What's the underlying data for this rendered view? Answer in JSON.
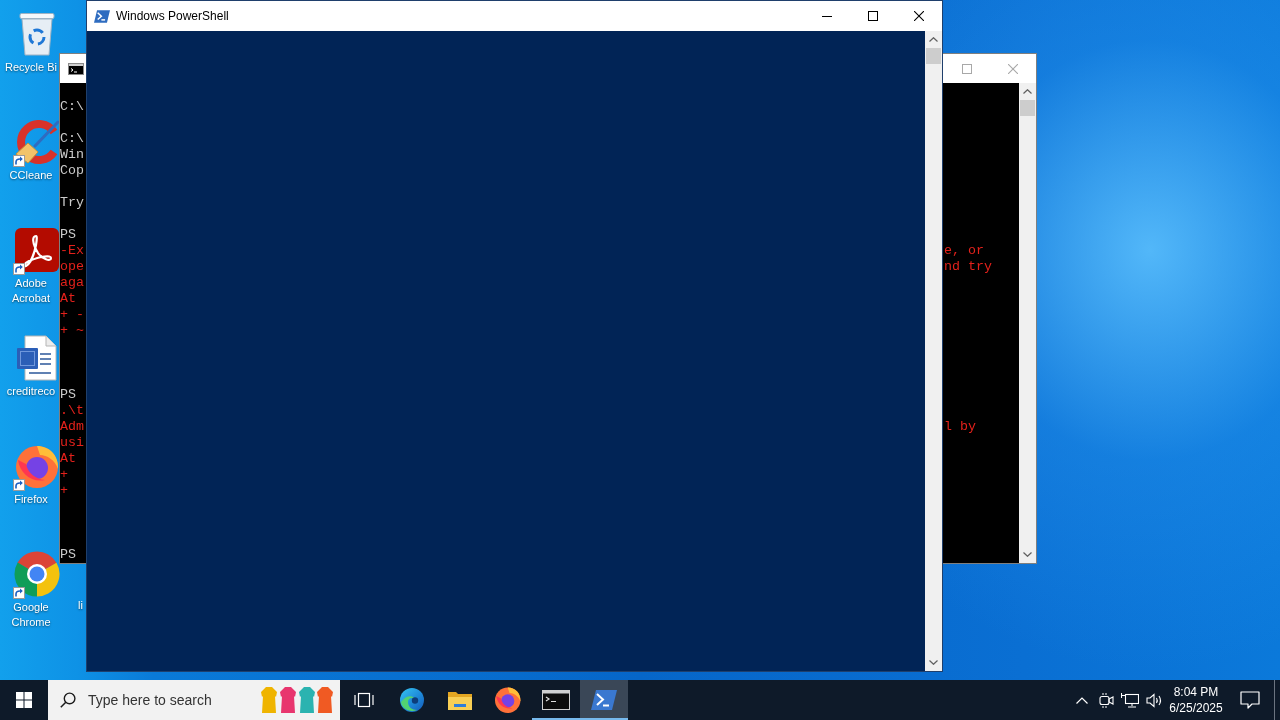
{
  "desktop": {
    "icons": [
      {
        "label": "Recycle Bi",
        "kind": "recycle-bin",
        "shortcut": false
      },
      {
        "label": "CCleane",
        "kind": "cleaner",
        "shortcut": true
      },
      {
        "label": "Adobe Acrobat",
        "kind": "pdf",
        "shortcut": true
      },
      {
        "label": "creditreco",
        "kind": "word-doc",
        "shortcut": false
      },
      {
        "label": "Firefox",
        "kind": "firefox",
        "shortcut": true
      },
      {
        "label": "Google Chrome",
        "kind": "chrome",
        "shortcut": true
      },
      {
        "label": "li",
        "kind": "covered"
      }
    ]
  },
  "console_window": {
    "active": false,
    "lines": [
      {
        "kind": "blank"
      },
      {
        "kind": "output",
        "start": "C:\\"
      },
      {
        "kind": "blank"
      },
      {
        "kind": "output",
        "start": "C:\\"
      },
      {
        "kind": "output",
        "start": "Win"
      },
      {
        "kind": "output",
        "start": "Cop"
      },
      {
        "kind": "blank"
      },
      {
        "kind": "output",
        "start": "Try"
      },
      {
        "kind": "blank"
      },
      {
        "kind": "output",
        "start": "PS"
      },
      {
        "kind": "error",
        "start": "-Ex",
        "end": "e, or"
      },
      {
        "kind": "error",
        "start": "ope",
        "end": "nd try"
      },
      {
        "kind": "error",
        "start": "aga"
      },
      {
        "kind": "error",
        "start": "At"
      },
      {
        "kind": "error",
        "start": "+ -"
      },
      {
        "kind": "error",
        "start": "+ ~"
      },
      {
        "kind": "blank"
      },
      {
        "kind": "blank"
      },
      {
        "kind": "blank"
      },
      {
        "kind": "output",
        "start": "PS"
      },
      {
        "kind": "error",
        "start": ".\\t"
      },
      {
        "kind": "error",
        "start": "Adm",
        "end": "l by"
      },
      {
        "kind": "error",
        "start": "usi"
      },
      {
        "kind": "error",
        "start": "At"
      },
      {
        "kind": "error",
        "start": "+"
      },
      {
        "kind": "error",
        "start": "+"
      },
      {
        "kind": "blank"
      },
      {
        "kind": "blank"
      },
      {
        "kind": "blank"
      },
      {
        "kind": "output",
        "start": "PS"
      }
    ]
  },
  "powershell_window": {
    "title": "Windows PowerShell",
    "active": true
  },
  "taskbar": {
    "search": {
      "placeholder": "Type here to search"
    },
    "apps": [
      {
        "kind": "edge",
        "open": false,
        "selected": false
      },
      {
        "kind": "explorer",
        "open": false,
        "selected": false
      },
      {
        "kind": "firefox",
        "open": false,
        "selected": false
      },
      {
        "kind": "cmd",
        "open": true,
        "selected": false
      },
      {
        "kind": "powershell",
        "open": true,
        "selected": true
      }
    ],
    "clock": {
      "time": "8:04 PM",
      "date": "6/25/2025"
    }
  }
}
